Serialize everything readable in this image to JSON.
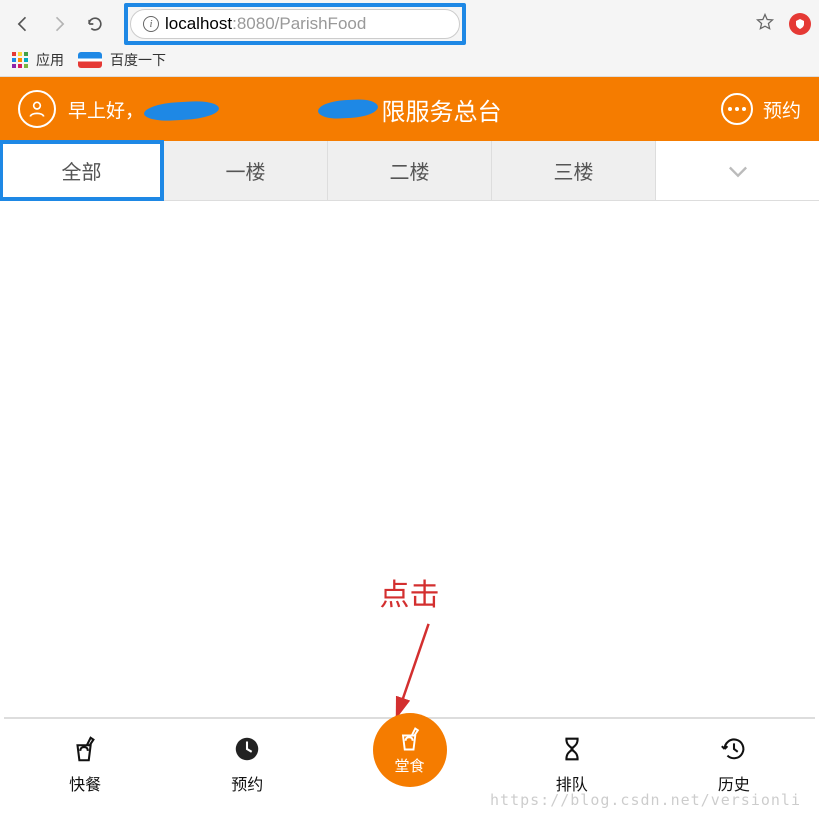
{
  "browser": {
    "url_host": "localhost",
    "url_port_path": ":8080/ParishFood",
    "bookmarks": {
      "apps": "应用",
      "baidu": "百度一下"
    }
  },
  "header": {
    "greeting": "早上好，",
    "title_suffix": "限服务总台",
    "right_action": "预约"
  },
  "tabs": [
    "全部",
    "一楼",
    "二楼",
    "三楼"
  ],
  "annotation": "点击",
  "bottomNav": [
    {
      "label": "快餐",
      "icon": "cup"
    },
    {
      "label": "预约",
      "icon": "clock"
    },
    {
      "label": "堂食",
      "icon": "cup",
      "active": true
    },
    {
      "label": "排队",
      "icon": "hourglass"
    },
    {
      "label": "历史",
      "icon": "history"
    }
  ],
  "watermark": "https://blog.csdn.net/versionli"
}
